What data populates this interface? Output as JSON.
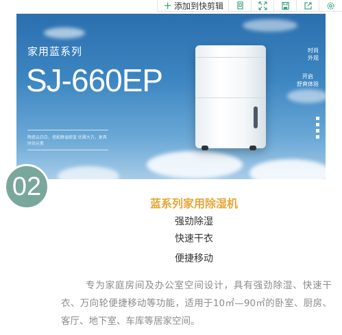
{
  "toolbar": {
    "clip_label": "添加到快剪辑",
    "icons": [
      "copy-icon",
      "expand-icon",
      "save-icon",
      "share-icon",
      "settings-icon"
    ]
  },
  "banner": {
    "series": "家用蓝系列",
    "model": "SJ-660EP",
    "small_text": "陶瓷云白白，搭配静谧蔚蓝 优雅大方，更具时尚元素",
    "right_top": "时尚\n外观",
    "right_bottom": "开启\n舒爽体验"
  },
  "badge": {
    "number": "02"
  },
  "product": {
    "title": "蓝系列家用除湿机",
    "features": [
      "强劲除湿",
      "快速干衣",
      "便捷移动"
    ],
    "description": "专为家庭房间及办公室空间设计，具有强劲除湿、快速干衣、万向轮便捷移动等功能，适用于10㎡—90㎡的卧室、厨房、客厅、地下室、车库等居家空间。"
  },
  "colors": {
    "title": "#e8a637",
    "badge": "#7aa79b",
    "banner": "#3d86c2"
  }
}
